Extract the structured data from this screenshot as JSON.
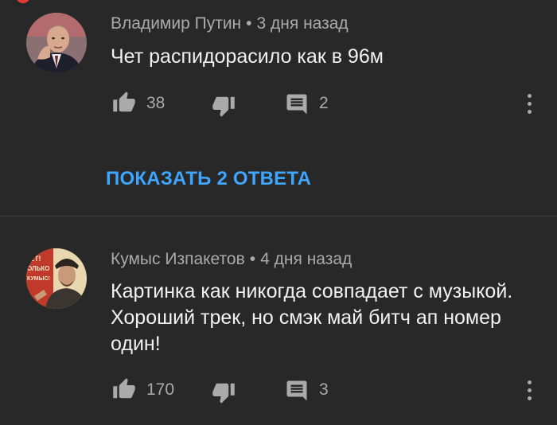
{
  "colors": {
    "background": "#282828",
    "meta_text": "#aaaaaa",
    "accent_link": "#3ea6ff",
    "notification_dot": "#e53935"
  },
  "comments": [
    {
      "author": "Владимир Путин",
      "separator": "•",
      "time_ago": "3 дня назад",
      "text": "Чет распидорасило как в 96м",
      "likes": "38",
      "replies_count": "2",
      "icons": [
        "like-icon",
        "dislike-icon",
        "reply-icon",
        "more-options-icon"
      ]
    },
    {
      "author": "Кумыс Изпакетов",
      "separator": "•",
      "time_ago": "4 дня назад",
      "text": "Картинка как никогда совпадает с музыкой. Хороший трек, но смэк май битч ап номер один!",
      "likes": "170",
      "replies_count": "3",
      "icons": [
        "like-icon",
        "dislike-icon",
        "reply-icon",
        "more-options-icon"
      ]
    }
  ],
  "show_replies_label": "ПОКАЗАТЬ 2 ОТВЕТА",
  "avatar2_poster_text": [
    "ЕТ!",
    "ОЛЬКО",
    "КУМЫС!"
  ]
}
